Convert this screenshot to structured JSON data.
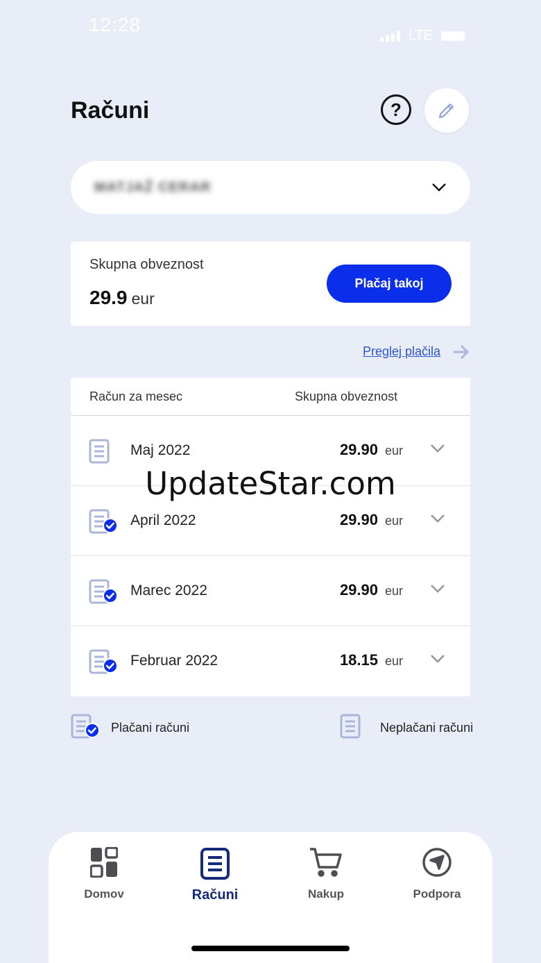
{
  "status": {
    "time": "12:28",
    "network": "LTE"
  },
  "header": {
    "title": "Računi",
    "help_symbol": "?"
  },
  "account": {
    "name": "MATJAŽ CERAR"
  },
  "summary": {
    "label": "Skupna obveznost",
    "amount": "29.9",
    "unit": "eur",
    "pay_label": "Plačaj takoj"
  },
  "payments_link": "Preglej plačila",
  "table": {
    "col_month": "Račun za mesec",
    "col_total": "Skupna obveznost",
    "rows": [
      {
        "month": "Maj 2022",
        "amount": "29.90",
        "unit": "eur",
        "paid": false
      },
      {
        "month": "April 2022",
        "amount": "29.90",
        "unit": "eur",
        "paid": true
      },
      {
        "month": "Marec 2022",
        "amount": "29.90",
        "unit": "eur",
        "paid": true
      },
      {
        "month": "Februar 2022",
        "amount": "18.15",
        "unit": "eur",
        "paid": true
      }
    ]
  },
  "legend": {
    "paid": "Plačani računi",
    "unpaid": "Neplačani računi"
  },
  "watermark": "UpdateStar.com",
  "tabs": [
    {
      "label": "Domov",
      "icon": "grid-icon",
      "active": false
    },
    {
      "label": "Računi",
      "icon": "document-icon",
      "active": true
    },
    {
      "label": "Nakup",
      "icon": "cart-icon",
      "active": false
    },
    {
      "label": "Podpora",
      "icon": "compass-icon",
      "active": false
    }
  ],
  "colors": {
    "accent": "#0a2eea",
    "active_tab": "#142a7a",
    "icon_muted": "#a9b6d8",
    "background": "#e9edf7"
  }
}
